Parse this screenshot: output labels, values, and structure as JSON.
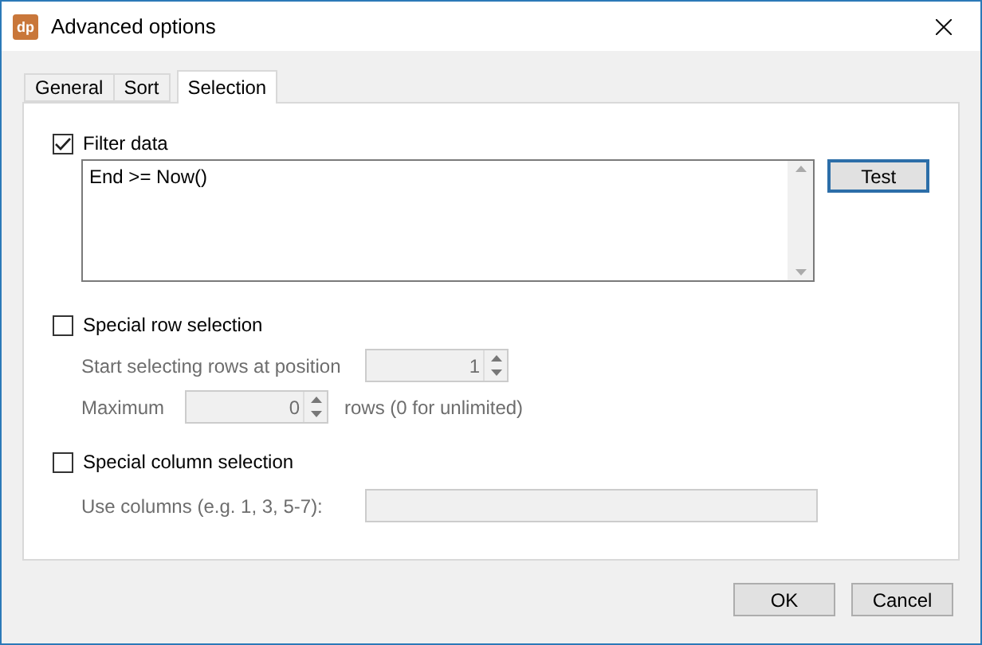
{
  "window": {
    "icon_text": "dp",
    "title": "Advanced options"
  },
  "tabs": [
    {
      "label": "General",
      "selected": false
    },
    {
      "label": "Sort",
      "selected": false
    },
    {
      "label": "Selection",
      "selected": true
    }
  ],
  "filter": {
    "label": "Filter data",
    "checked": true,
    "expression": "End >= Now()",
    "button": "Test"
  },
  "row_selection": {
    "label": "Special row selection",
    "checked": false,
    "start_label": "Start selecting rows at position",
    "start_value": "1",
    "max_label": "Maximum",
    "max_value": "0",
    "max_suffix": "rows (0 for unlimited)",
    "disabled": true
  },
  "column_selection": {
    "label": "Special column selection",
    "checked": false,
    "columns_label": "Use columns (e.g. 1, 3, 5-7):",
    "disabled": true
  },
  "buttons": [
    {
      "label": "OK"
    },
    {
      "label": "Cancel"
    }
  ]
}
